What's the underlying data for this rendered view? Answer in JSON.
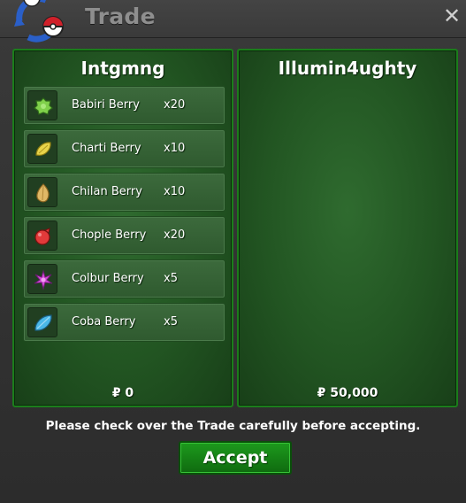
{
  "window": {
    "title": "Trade",
    "close_icon": "close-icon"
  },
  "left_panel": {
    "player": "Intgmng",
    "money": "₽ 0",
    "items": [
      {
        "name": "Babiri Berry",
        "qty": "x20",
        "icon": "babiri-berry-icon",
        "color": "#7fd04a"
      },
      {
        "name": "Charti Berry",
        "qty": "x10",
        "icon": "charti-berry-icon",
        "color": "#e8d34a"
      },
      {
        "name": "Chilan Berry",
        "qty": "x10",
        "icon": "chilan-berry-icon",
        "color": "#e0b866"
      },
      {
        "name": "Chople Berry",
        "qty": "x20",
        "icon": "chople-berry-icon",
        "color": "#e23a3a"
      },
      {
        "name": "Colbur Berry",
        "qty": "x5",
        "icon": "colbur-berry-icon",
        "color": "#d34ad8"
      },
      {
        "name": "Coba Berry",
        "qty": "x5",
        "icon": "coba-berry-icon",
        "color": "#4ab8e8"
      }
    ]
  },
  "right_panel": {
    "player": "Illumin4ughty",
    "money": "₽ 50,000"
  },
  "notice": "Please check over the Trade carefully before accepting.",
  "accept_label": "Accept",
  "colors": {
    "panel_border": "#1b7d1b",
    "accept": "#1d9a1d"
  }
}
